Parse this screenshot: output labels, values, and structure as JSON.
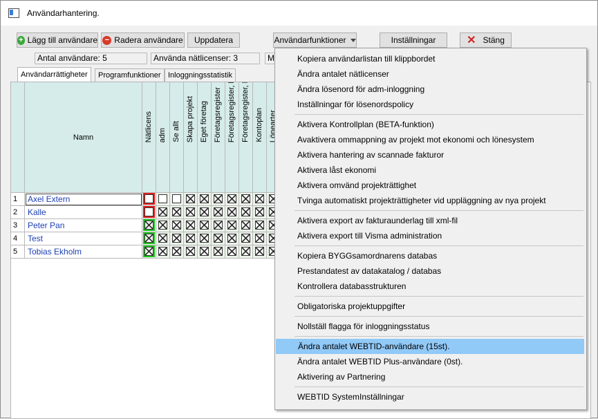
{
  "window": {
    "title": "Användarhantering."
  },
  "toolbar": {
    "add_user": "Lägg till användare",
    "delete_user": "Radera användare",
    "update": "Uppdatera",
    "user_functions": "Användarfunktioner",
    "settings": "Inställningar",
    "close": "Stäng"
  },
  "info": {
    "user_count": "Antal användare: 5",
    "licenses_used": "Använda nätlicenser: 3",
    "third": "M"
  },
  "tabs": [
    "Användarrättigheter",
    "Programfunktioner",
    "Inloggningsstatistik"
  ],
  "grid": {
    "name_header": "Namn",
    "columns": [
      "Nätlicens",
      "adm",
      "Se allt",
      "Skapa projekt",
      "Eget företag",
      "Företagsregister",
      "Företagsregister, lev bed",
      "Företagsregister, kontakter",
      "Kontoplan",
      "Lönearter"
    ],
    "rows": [
      {
        "num": "1",
        "name": "Axel Extern",
        "checks": [
          0,
          0,
          0,
          1,
          1,
          1,
          1,
          1,
          1,
          1
        ],
        "highlight": "red"
      },
      {
        "num": "2",
        "name": "Kalle",
        "checks": [
          0,
          1,
          1,
          1,
          1,
          1,
          1,
          1,
          1,
          1
        ],
        "highlight": "red"
      },
      {
        "num": "3",
        "name": "Peter Pan",
        "checks": [
          1,
          1,
          1,
          1,
          1,
          1,
          1,
          1,
          1,
          1
        ],
        "highlight": "green"
      },
      {
        "num": "4",
        "name": "Test",
        "checks": [
          1,
          1,
          1,
          1,
          1,
          1,
          1,
          1,
          1,
          1
        ],
        "highlight": "green"
      },
      {
        "num": "5",
        "name": "Tobias Ekholm",
        "checks": [
          1,
          1,
          1,
          1,
          1,
          1,
          1,
          1,
          1,
          1
        ],
        "highlight": "green"
      }
    ]
  },
  "menu": {
    "groups": [
      [
        "Kopiera användarlistan till klippbordet",
        "Ändra antalet nätlicenser",
        "Ändra lösenord för adm-inloggning",
        "Inställningar för lösenordspolicy"
      ],
      [
        "Aktivera Kontrollplan (BETA-funktion)",
        "Avaktivera ommappning av projekt mot ekonomi och lönesystem",
        "Aktivera hantering av scannade fakturor",
        "Aktivera låst ekonomi",
        "Aktivera omvänd projekträttighet",
        "Tvinga automatiskt projekträttigheter vid uppläggning av nya projekt"
      ],
      [
        "Aktivera export av fakturaunderlag till xml-fil",
        "Aktivera export till Visma administration"
      ],
      [
        "Kopiera BYGGsamordnarens databas",
        "Prestandatest av datakatalog / databas",
        "Kontrollera databasstrukturen"
      ],
      [
        "Obligatoriska projektuppgifter"
      ],
      [
        "Nollställ flagga för inloggningsstatus"
      ],
      [
        "Ändra antalet WEBTID-användare (15st).",
        "Ändra antalet WEBTID Plus-användare (0st).",
        "Aktivering av Partnering"
      ],
      [
        "WEBTID SystemInställningar"
      ]
    ],
    "selected": "Ändra antalet WEBTID-användare (15st)."
  }
}
